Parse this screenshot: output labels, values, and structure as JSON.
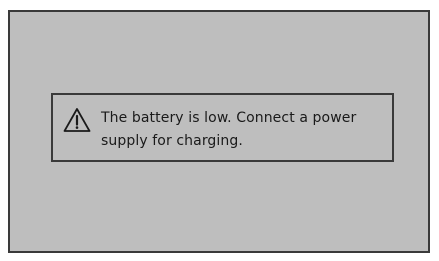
{
  "alert": {
    "icon": "warning-triangle-icon",
    "message_lines": [
      "The battery is low. Connect a power",
      "supply for charging."
    ]
  },
  "colors": {
    "screen_background": "#bebebe",
    "border": "#3a3a3a",
    "text": "#1a1a1a"
  }
}
